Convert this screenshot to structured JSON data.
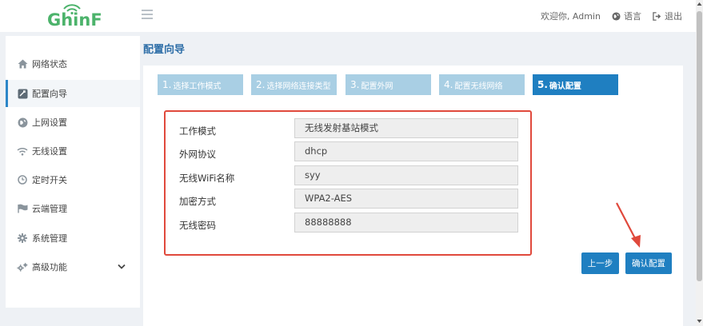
{
  "header": {
    "logo_text": "GhinF",
    "welcome": "欢迎你, Admin",
    "language": "语言",
    "logout": "退出"
  },
  "sidebar": {
    "items": [
      {
        "label": "网络状态",
        "icon": "home-icon"
      },
      {
        "label": "配置向导",
        "icon": "wizard-icon",
        "active": true
      },
      {
        "label": "上网设置",
        "icon": "globe-icon"
      },
      {
        "label": "无线设置",
        "icon": "wifi-icon"
      },
      {
        "label": "定时开关",
        "icon": "clock-icon"
      },
      {
        "label": "云端管理",
        "icon": "flag-icon"
      },
      {
        "label": "系统管理",
        "icon": "gear-icon"
      },
      {
        "label": "高级功能",
        "icon": "gears-icon",
        "expandable": true
      }
    ]
  },
  "main": {
    "title": "配置向导",
    "steps": [
      {
        "num": "1.",
        "label": "选择工作模式"
      },
      {
        "num": "2.",
        "label": "选择网络连接类型"
      },
      {
        "num": "3.",
        "label": "配置外网"
      },
      {
        "num": "4.",
        "label": "配置无线网络"
      },
      {
        "num": "5.",
        "label": "确认配置",
        "current": true
      }
    ],
    "summary": [
      {
        "label": "工作模式",
        "value": "无线发射基站模式"
      },
      {
        "label": "外网协议",
        "value": "dhcp"
      },
      {
        "label": "无线WiFi名称",
        "value": "syy"
      },
      {
        "label": "加密方式",
        "value": "WPA2-AES"
      },
      {
        "label": "无线密码",
        "value": "88888888"
      }
    ],
    "buttons": {
      "prev": "上一步",
      "confirm": "确认配置"
    }
  },
  "colors": {
    "accent": "#1f7fc1",
    "step_inactive": "#a9cfe4",
    "highlight_box": "#e0493c",
    "logo_green": "#4cb36b"
  }
}
